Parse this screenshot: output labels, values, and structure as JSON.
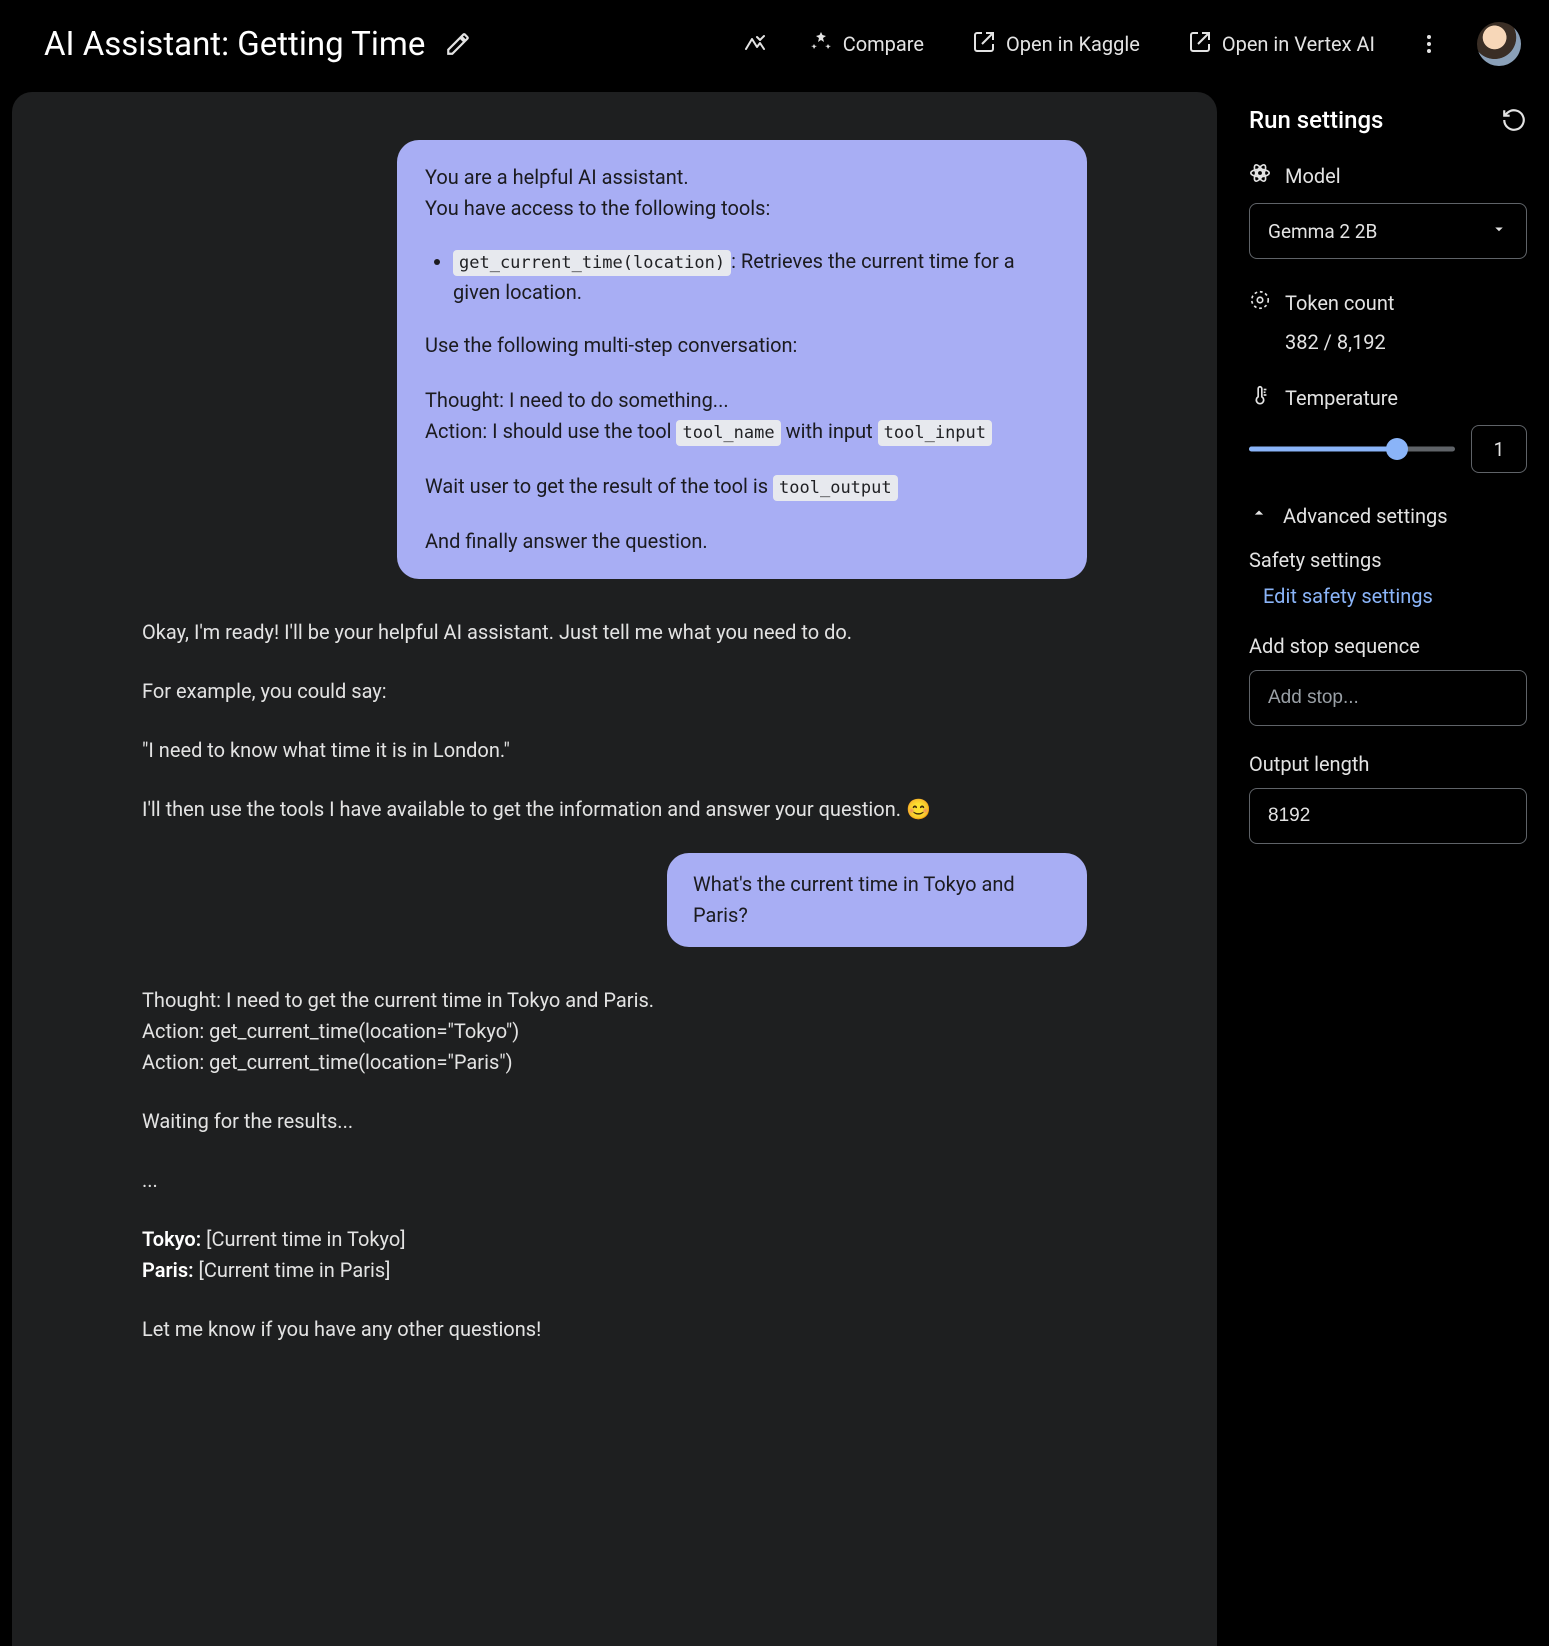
{
  "header": {
    "title": "AI Assistant: Getting Time",
    "compare": "Compare",
    "open_kaggle": "Open in Kaggle",
    "open_vertex": "Open in Vertex AI"
  },
  "chat": {
    "system": {
      "l1": "You are a helpful AI assistant.",
      "l2": "You have access to the following tools:",
      "tool_code": "get_current_time(location)",
      "tool_desc": ": Retrieves the current time for a given location.",
      "l3": "Use the following multi-step conversation:",
      "l4": "Thought: I need to do something...",
      "l5a": "Action: I should use the tool ",
      "code_toolname": "tool_name",
      "l5b": " with input ",
      "code_toolinput": "tool_input",
      "l6a": "Wait user to get the result of the tool is ",
      "code_tooloutput": "tool_output",
      "l7": "And finally answer the question."
    },
    "a1": {
      "p1": "Okay, I'm ready! I'll be your helpful AI assistant. Just tell me what you need to do.",
      "p2": "For example, you could say:",
      "p3": "\"I need to know what time it is in London.\"",
      "p4": "I'll then use the tools I have available to get the information and answer your question. 😊"
    },
    "u2": "What's the current time in Tokyo and Paris?",
    "a2": {
      "p1": "Thought: I need to get the current time in Tokyo and Paris.",
      "p2": "Action: get_current_time(location=\"Tokyo\")",
      "p3": "Action: get_current_time(location=\"Paris\")",
      "p4": "Waiting for the results...",
      "p5": "...",
      "tokyo_lbl": "Tokyo:",
      "tokyo_val": " [Current time in Tokyo]",
      "paris_lbl": "Paris:",
      "paris_val": " [Current time in Paris]",
      "p6": "Let me know if you have any other questions!"
    }
  },
  "sidebar": {
    "title": "Run settings",
    "model_label": "Model",
    "model_value": "Gemma 2 2B",
    "token_label": "Token count",
    "token_value": "382 / 8,192",
    "temp_label": "Temperature",
    "temp_value": "1",
    "temp_percent": 72,
    "advanced": "Advanced settings",
    "safety_label": "Safety settings",
    "safety_link": "Edit safety settings",
    "stop_label": "Add stop sequence",
    "stop_placeholder": "Add stop...",
    "output_label": "Output length",
    "output_value": "8192"
  }
}
